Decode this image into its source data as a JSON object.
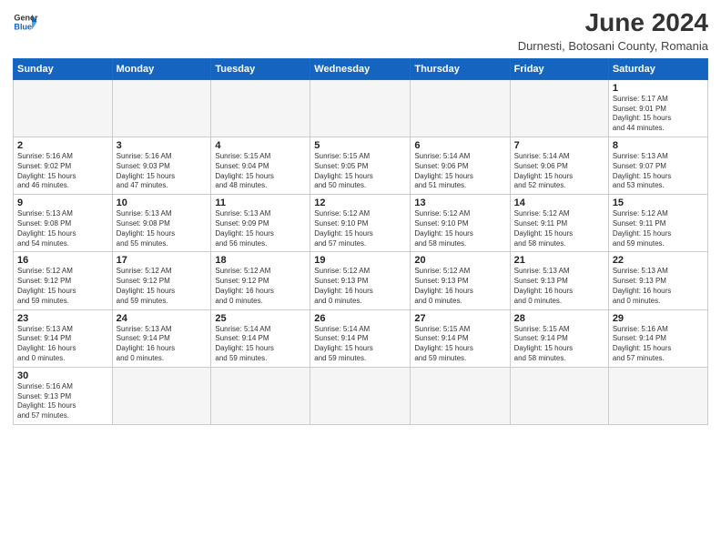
{
  "header": {
    "logo_general": "General",
    "logo_blue": "Blue",
    "title": "June 2024",
    "location": "Durnesti, Botosani County, Romania"
  },
  "weekdays": [
    "Sunday",
    "Monday",
    "Tuesday",
    "Wednesday",
    "Thursday",
    "Friday",
    "Saturday"
  ],
  "weeks": [
    [
      {
        "day": "",
        "info": ""
      },
      {
        "day": "",
        "info": ""
      },
      {
        "day": "",
        "info": ""
      },
      {
        "day": "",
        "info": ""
      },
      {
        "day": "",
        "info": ""
      },
      {
        "day": "",
        "info": ""
      },
      {
        "day": "1",
        "info": "Sunrise: 5:17 AM\nSunset: 9:01 PM\nDaylight: 15 hours\nand 44 minutes."
      }
    ],
    [
      {
        "day": "2",
        "info": "Sunrise: 5:16 AM\nSunset: 9:02 PM\nDaylight: 15 hours\nand 46 minutes."
      },
      {
        "day": "3",
        "info": "Sunrise: 5:16 AM\nSunset: 9:03 PM\nDaylight: 15 hours\nand 47 minutes."
      },
      {
        "day": "4",
        "info": "Sunrise: 5:15 AM\nSunset: 9:04 PM\nDaylight: 15 hours\nand 48 minutes."
      },
      {
        "day": "5",
        "info": "Sunrise: 5:15 AM\nSunset: 9:05 PM\nDaylight: 15 hours\nand 50 minutes."
      },
      {
        "day": "6",
        "info": "Sunrise: 5:14 AM\nSunset: 9:06 PM\nDaylight: 15 hours\nand 51 minutes."
      },
      {
        "day": "7",
        "info": "Sunrise: 5:14 AM\nSunset: 9:06 PM\nDaylight: 15 hours\nand 52 minutes."
      },
      {
        "day": "8",
        "info": "Sunrise: 5:13 AM\nSunset: 9:07 PM\nDaylight: 15 hours\nand 53 minutes."
      }
    ],
    [
      {
        "day": "9",
        "info": "Sunrise: 5:13 AM\nSunset: 9:08 PM\nDaylight: 15 hours\nand 54 minutes."
      },
      {
        "day": "10",
        "info": "Sunrise: 5:13 AM\nSunset: 9:08 PM\nDaylight: 15 hours\nand 55 minutes."
      },
      {
        "day": "11",
        "info": "Sunrise: 5:13 AM\nSunset: 9:09 PM\nDaylight: 15 hours\nand 56 minutes."
      },
      {
        "day": "12",
        "info": "Sunrise: 5:12 AM\nSunset: 9:10 PM\nDaylight: 15 hours\nand 57 minutes."
      },
      {
        "day": "13",
        "info": "Sunrise: 5:12 AM\nSunset: 9:10 PM\nDaylight: 15 hours\nand 58 minutes."
      },
      {
        "day": "14",
        "info": "Sunrise: 5:12 AM\nSunset: 9:11 PM\nDaylight: 15 hours\nand 58 minutes."
      },
      {
        "day": "15",
        "info": "Sunrise: 5:12 AM\nSunset: 9:11 PM\nDaylight: 15 hours\nand 59 minutes."
      }
    ],
    [
      {
        "day": "16",
        "info": "Sunrise: 5:12 AM\nSunset: 9:12 PM\nDaylight: 15 hours\nand 59 minutes."
      },
      {
        "day": "17",
        "info": "Sunrise: 5:12 AM\nSunset: 9:12 PM\nDaylight: 15 hours\nand 59 minutes."
      },
      {
        "day": "18",
        "info": "Sunrise: 5:12 AM\nSunset: 9:12 PM\nDaylight: 16 hours\nand 0 minutes."
      },
      {
        "day": "19",
        "info": "Sunrise: 5:12 AM\nSunset: 9:13 PM\nDaylight: 16 hours\nand 0 minutes."
      },
      {
        "day": "20",
        "info": "Sunrise: 5:12 AM\nSunset: 9:13 PM\nDaylight: 16 hours\nand 0 minutes."
      },
      {
        "day": "21",
        "info": "Sunrise: 5:13 AM\nSunset: 9:13 PM\nDaylight: 16 hours\nand 0 minutes."
      },
      {
        "day": "22",
        "info": "Sunrise: 5:13 AM\nSunset: 9:13 PM\nDaylight: 16 hours\nand 0 minutes."
      }
    ],
    [
      {
        "day": "23",
        "info": "Sunrise: 5:13 AM\nSunset: 9:14 PM\nDaylight: 16 hours\nand 0 minutes."
      },
      {
        "day": "24",
        "info": "Sunrise: 5:13 AM\nSunset: 9:14 PM\nDaylight: 16 hours\nand 0 minutes."
      },
      {
        "day": "25",
        "info": "Sunrise: 5:14 AM\nSunset: 9:14 PM\nDaylight: 15 hours\nand 59 minutes."
      },
      {
        "day": "26",
        "info": "Sunrise: 5:14 AM\nSunset: 9:14 PM\nDaylight: 15 hours\nand 59 minutes."
      },
      {
        "day": "27",
        "info": "Sunrise: 5:15 AM\nSunset: 9:14 PM\nDaylight: 15 hours\nand 59 minutes."
      },
      {
        "day": "28",
        "info": "Sunrise: 5:15 AM\nSunset: 9:14 PM\nDaylight: 15 hours\nand 58 minutes."
      },
      {
        "day": "29",
        "info": "Sunrise: 5:16 AM\nSunset: 9:14 PM\nDaylight: 15 hours\nand 57 minutes."
      }
    ],
    [
      {
        "day": "30",
        "info": "Sunrise: 5:16 AM\nSunset: 9:13 PM\nDaylight: 15 hours\nand 57 minutes."
      },
      {
        "day": "",
        "info": ""
      },
      {
        "day": "",
        "info": ""
      },
      {
        "day": "",
        "info": ""
      },
      {
        "day": "",
        "info": ""
      },
      {
        "day": "",
        "info": ""
      },
      {
        "day": "",
        "info": ""
      }
    ]
  ]
}
